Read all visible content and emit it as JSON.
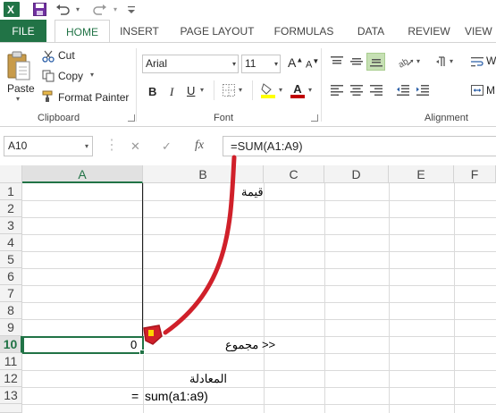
{
  "qat": {
    "icons": [
      "excel-logo-icon",
      "save-icon",
      "undo-icon",
      "redo-icon",
      "customize-qat-icon"
    ],
    "excel_logo_glyph": "X"
  },
  "tabs": [
    {
      "label": "FILE"
    },
    {
      "label": "HOME"
    },
    {
      "label": "INSERT"
    },
    {
      "label": "PAGE LAYOUT"
    },
    {
      "label": "FORMULAS"
    },
    {
      "label": "DATA"
    },
    {
      "label": "REVIEW"
    },
    {
      "label": "VIEW"
    }
  ],
  "ribbon": {
    "clipboard": {
      "paste_label": "Paste",
      "cut_label": "Cut",
      "copy_label": "Copy",
      "format_painter_label": "Format Painter",
      "group_label": "Clipboard"
    },
    "font": {
      "font_name": "Arial",
      "font_size": "11",
      "grow_label": "A",
      "shrink_label": "A",
      "bold_label": "B",
      "italic_label": "I",
      "underline_label": "U",
      "font_color_label": "A",
      "group_label": "Font",
      "highlight_color": "#ffff00",
      "font_color": "#c00000"
    },
    "alignment": {
      "group_label": "Alignment",
      "wrap_label": "W",
      "merge_label": "M"
    }
  },
  "formula_bar": {
    "name_box": "A10",
    "fx_label": "fx",
    "cancel_label": "✕",
    "enter_label": "✓",
    "formula": "=SUM(A1:A9)"
  },
  "sheet": {
    "columns": [
      "A",
      "B",
      "C",
      "D",
      "E",
      "F"
    ],
    "selected_column": "A",
    "rows": [
      "1",
      "2",
      "3",
      "4",
      "5",
      "6",
      "7",
      "8",
      "9",
      "10",
      "11",
      "12",
      "13"
    ],
    "selected_row": "10",
    "cells": {
      "b1": "قيمة",
      "a10": "0",
      "b10": "<< مجموع",
      "b12": "المعادلة",
      "a13": "=",
      "b13": "sum(a1:a9)"
    }
  },
  "colors": {
    "accent": "#217346",
    "arrow": "#d0202a",
    "marker_fill": "#ffd400"
  }
}
